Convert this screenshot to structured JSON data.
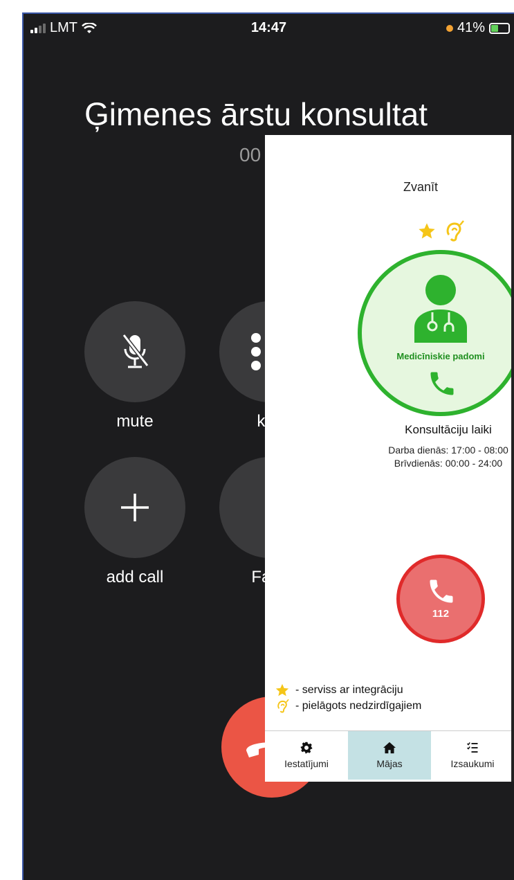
{
  "status_bar": {
    "carrier": "LMT",
    "time": "14:47",
    "battery": "41%"
  },
  "call": {
    "title": "Ģimenes ārstu konsultat",
    "timer": "00",
    "buttons": [
      {
        "label": "mute",
        "icon": "mic-slash-icon"
      },
      {
        "label": "key",
        "icon": "keypad-icon"
      },
      {
        "label": "add call",
        "icon": "plus-icon"
      },
      {
        "label": "Face",
        "icon": "facetime-icon"
      }
    ],
    "end_call_icon": "phone-down-icon"
  },
  "app": {
    "header": "Zvanīt",
    "service_circle_label": "Medicīniskie padomi",
    "hours_title": "Konsultāciju laiki",
    "hours_weekdays": "Darba dienās: 17:00 - 08:00",
    "hours_weekend": "Brīvdienās: 00:00 - 24:00",
    "emergency_number": "112",
    "legend": [
      {
        "icon": "star-icon",
        "text": "- serviss ar integrāciju"
      },
      {
        "icon": "ear-icon",
        "text": "- pielāgots nedzirdīgajiem"
      }
    ],
    "tabs": [
      {
        "label": "Iestatījumi",
        "icon": "gear-icon"
      },
      {
        "label": "Mājas",
        "icon": "home-icon"
      },
      {
        "label": "Izsaukumi",
        "icon": "checklist-icon"
      }
    ],
    "colors": {
      "green": "#2eb22e",
      "emergency": "#e02a2a",
      "star": "#f5c518",
      "active_tab": "#c4e1e4"
    }
  }
}
